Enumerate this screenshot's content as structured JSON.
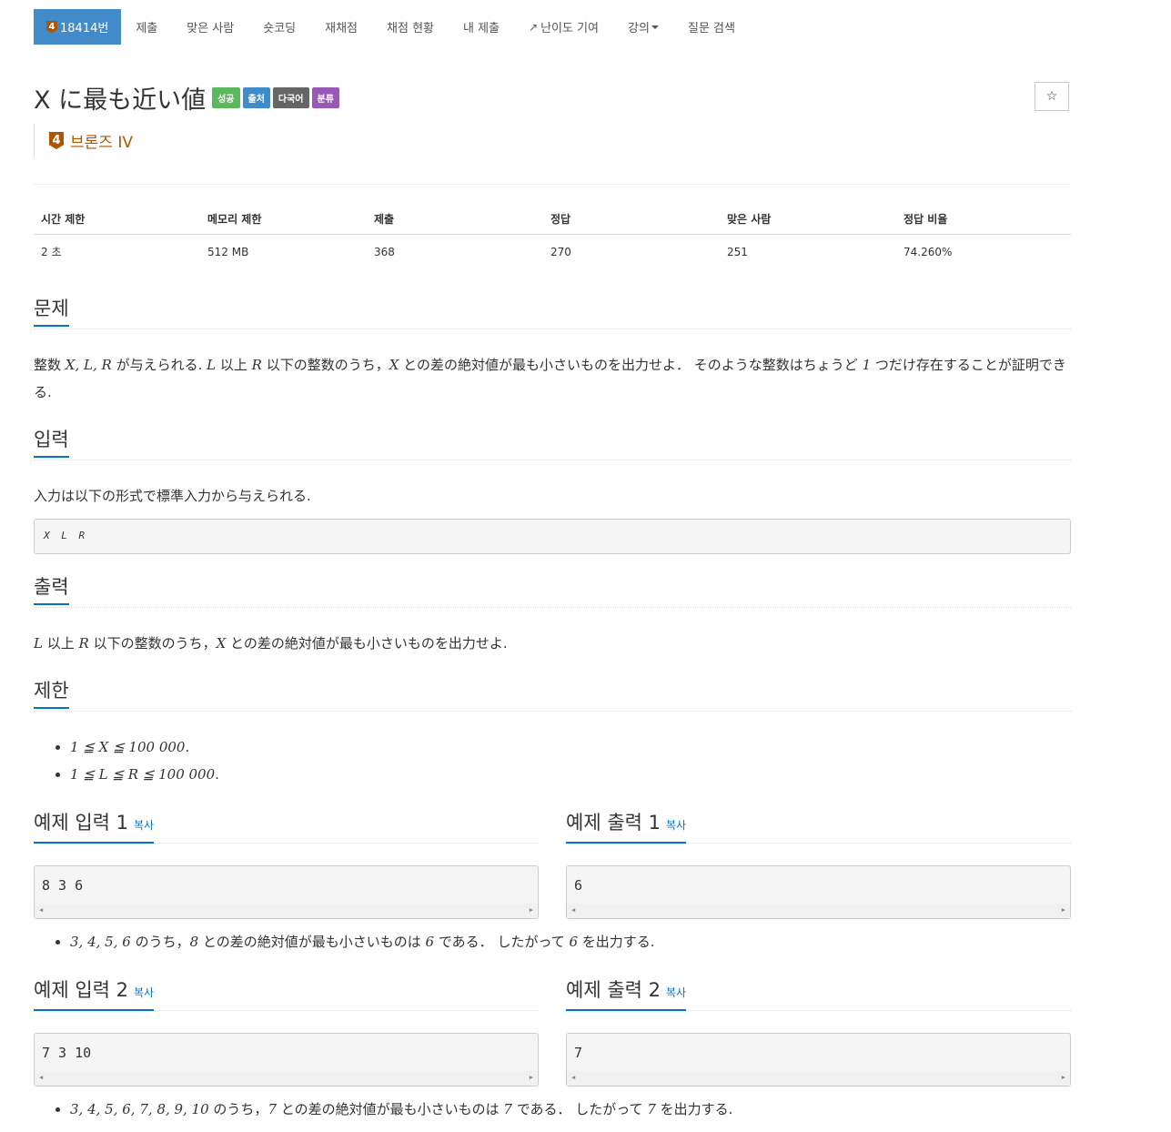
{
  "nav": {
    "problem_number": "18414번",
    "tier_digit": "4",
    "items": [
      "제출",
      "맞은 사람",
      "숏코딩",
      "재채점",
      "채점 현황",
      "내 제출",
      "난이도 기여",
      "강의",
      "질문 검색"
    ]
  },
  "problem": {
    "title": "X に最も近い値",
    "labels": [
      "성공",
      "출처",
      "다국어",
      "분류"
    ],
    "star": "☆",
    "tier_text": "브론즈 IV"
  },
  "info": {
    "headers": [
      "시간 제한",
      "메모리 제한",
      "제출",
      "정답",
      "맞은 사람",
      "정답 비율"
    ],
    "values": [
      "2 초",
      "512 MB",
      "368",
      "270",
      "251",
      "74.260%"
    ]
  },
  "sections": {
    "problem_heading": "문제",
    "problem_text_1": "整数 ",
    "problem_vars": "X, L, R",
    "problem_text_2": " が与えられる. ",
    "problem_L": "L",
    "problem_text_3": " 以上 ",
    "problem_R": "R",
    "problem_text_4": " 以下の整数のうち，",
    "problem_X": "X",
    "problem_text_5": " との差の絶対値が最も小さいものを出力せよ． そのような整数はちょうど ",
    "problem_one": "1",
    "problem_text_6": " つだけ存在することが証明できる.",
    "input_heading": "입력",
    "input_text": "入力は以下の形式で標準入力から与えられる.",
    "input_format": "X L R",
    "output_heading": "출력",
    "output_L": "L",
    "output_text_1": " 以上 ",
    "output_R": "R",
    "output_text_2": " 以下の整数のうち，",
    "output_X": "X",
    "output_text_3": " との差の絶対値が最も小さいものを出力せよ.",
    "limit_heading": "제한",
    "limits": [
      "1 ≦ X ≦ 100 000",
      "1 ≦ L ≦ R ≦ 100 000"
    ],
    "period": "."
  },
  "samples": {
    "copy_label": "복사",
    "input1_heading": "예제 입력 1",
    "output1_heading": "예제 출력 1",
    "input1": "8 3 6",
    "output1": "6",
    "note1_vars": "3, 4, 5, 6",
    "note1_text_1": " のうち，",
    "note1_x": "8",
    "note1_text_2": " との差の絶対値が最も小さいものは ",
    "note1_ans": "6",
    "note1_text_3": " である． したがって ",
    "note1_ans2": "6",
    "note1_text_4": " を出力する.",
    "input2_heading": "예제 입력 2",
    "output2_heading": "예제 출력 2",
    "input2": "7 3 10",
    "output2": "7",
    "note2_vars": "3, 4, 5, 6, 7, 8, 9, 10",
    "note2_text_1": " のうち，",
    "note2_x": "7",
    "note2_text_2": " との差の絶対値が最も小さいものは ",
    "note2_ans": "7",
    "note2_text_3": " である． したがって ",
    "note2_ans2": "7",
    "note2_text_4": " を出力する."
  },
  "colors": {
    "primary": "#428bca",
    "bronze": "#ad5600",
    "link": "#0076c0",
    "success": "#5cb85c",
    "purple": "#9b59b6"
  }
}
